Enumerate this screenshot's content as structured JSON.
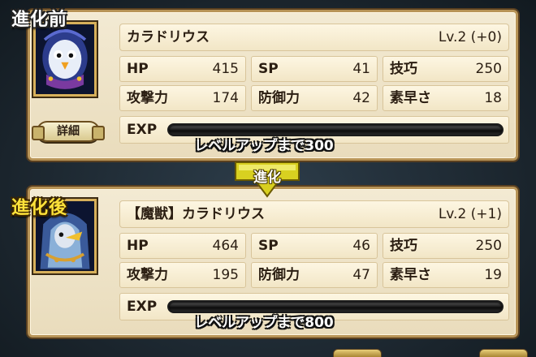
{
  "before": {
    "tag": "進化前",
    "name": "カラドリウス",
    "level": "Lv.2 (+0)",
    "detail_label": "詳細",
    "stats": {
      "hp_label": "HP",
      "hp": "415",
      "sp_label": "SP",
      "sp": "41",
      "skill_label": "技巧",
      "skill": "250",
      "atk_label": "攻撃力",
      "atk": "174",
      "def_label": "防御力",
      "def": "42",
      "agi_label": "素早さ",
      "agi": "18"
    },
    "exp_label": "EXP",
    "exp_text": "レベルアップまで300",
    "exp_progress": 0
  },
  "evolve_label": "進化",
  "after": {
    "tag": "進化後",
    "name": "【魔獣】カラドリウス",
    "level": "Lv.2 (+1)",
    "stats": {
      "hp_label": "HP",
      "hp": "464",
      "sp_label": "SP",
      "sp": "46",
      "skill_label": "技巧",
      "skill": "250",
      "atk_label": "攻撃力",
      "atk": "195",
      "def_label": "防御力",
      "def": "47",
      "agi_label": "素早さ",
      "agi": "19"
    },
    "exp_label": "EXP",
    "exp_text": "レベルアップまで800",
    "exp_progress": 0
  },
  "icons": {
    "before_portrait": "penguin-bird-monster-icon",
    "after_portrait": "hooded-bird-monster-icon",
    "evolve_arrow": "down-arrow-icon",
    "detail_button": "bone-button-icon"
  },
  "colors": {
    "panel_bg": "#f3ead3",
    "panel_border": "#b89457",
    "tag_after": "#ffe23a",
    "arrow": "#d8d020"
  }
}
